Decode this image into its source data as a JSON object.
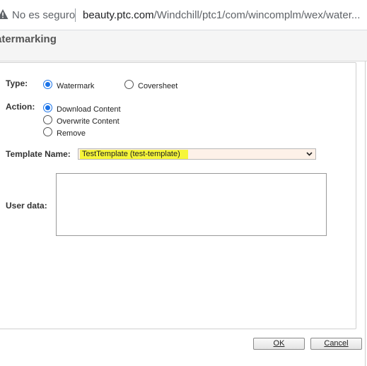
{
  "browser": {
    "security_label": "No es seguro",
    "url_host": "beauty.ptc.com",
    "url_path": "/Windchill/ptc1/com/wincomplm/wex/water..."
  },
  "dialog": {
    "title": "atermarking"
  },
  "form": {
    "type_label": "Type:",
    "type_options": [
      "Watermark",
      "Coversheet"
    ],
    "type_selected": "Watermark",
    "action_label": "Action:",
    "action_options": [
      "Download Content",
      "Overwrite Content",
      "Remove"
    ],
    "action_selected": "Download Content",
    "template_label": "Template Name:",
    "template_value": "TestTemplate (test-template)",
    "userdata_label": "User data:",
    "userdata_value": ""
  },
  "buttons": {
    "ok_label": "OK",
    "cancel_label": "Cancel"
  },
  "colors": {
    "highlight": "#f6f63a",
    "radio_accent": "#1a73e8",
    "select_bg": "#fdf1e8"
  }
}
